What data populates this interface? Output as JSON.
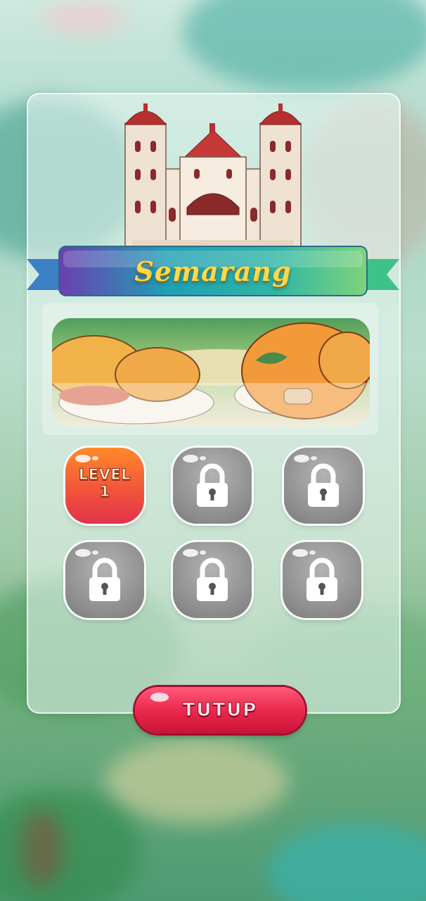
{
  "city": {
    "name": "Semarang"
  },
  "levels": [
    {
      "label_line1": "LEVEL",
      "label_line2": "1",
      "status": "unlocked",
      "icon": "level-badge"
    },
    {
      "status": "locked",
      "icon": "lock-icon"
    },
    {
      "status": "locked",
      "icon": "lock-icon"
    },
    {
      "status": "locked",
      "icon": "lock-icon"
    },
    {
      "status": "locked",
      "icon": "lock-icon"
    },
    {
      "status": "locked",
      "icon": "lock-icon"
    }
  ],
  "footer": {
    "close_label": "TUTUP"
  },
  "colors": {
    "banner_title": "#ffd84a",
    "close_button": "#e8264a",
    "level_unlocked": "#f2553a",
    "level_locked": "#8d8d8d"
  }
}
